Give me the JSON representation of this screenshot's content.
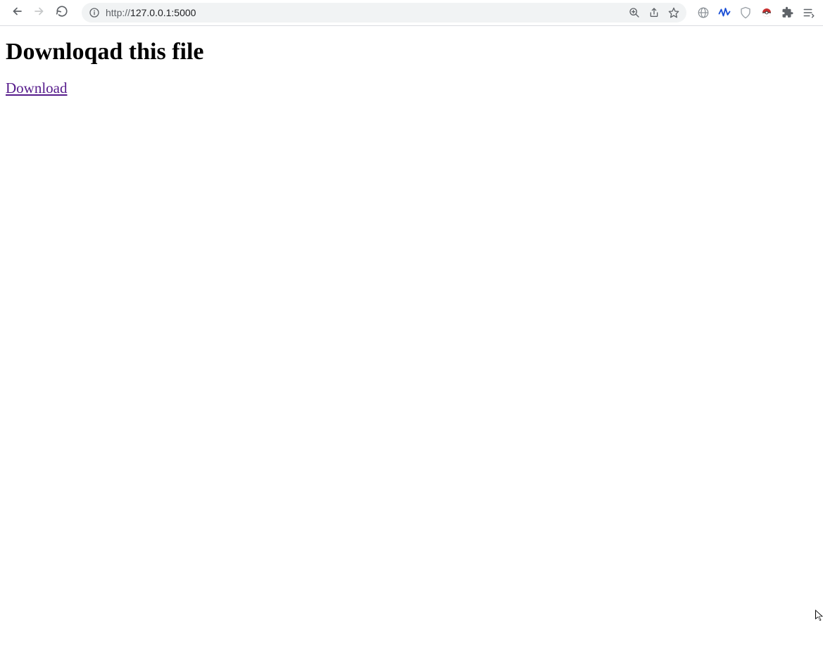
{
  "browser": {
    "url_prefix": "http://",
    "url_host": "127.0.0.1",
    "url_port": ":5000"
  },
  "page": {
    "heading": "Downloqad this file",
    "link_text": "Download"
  }
}
